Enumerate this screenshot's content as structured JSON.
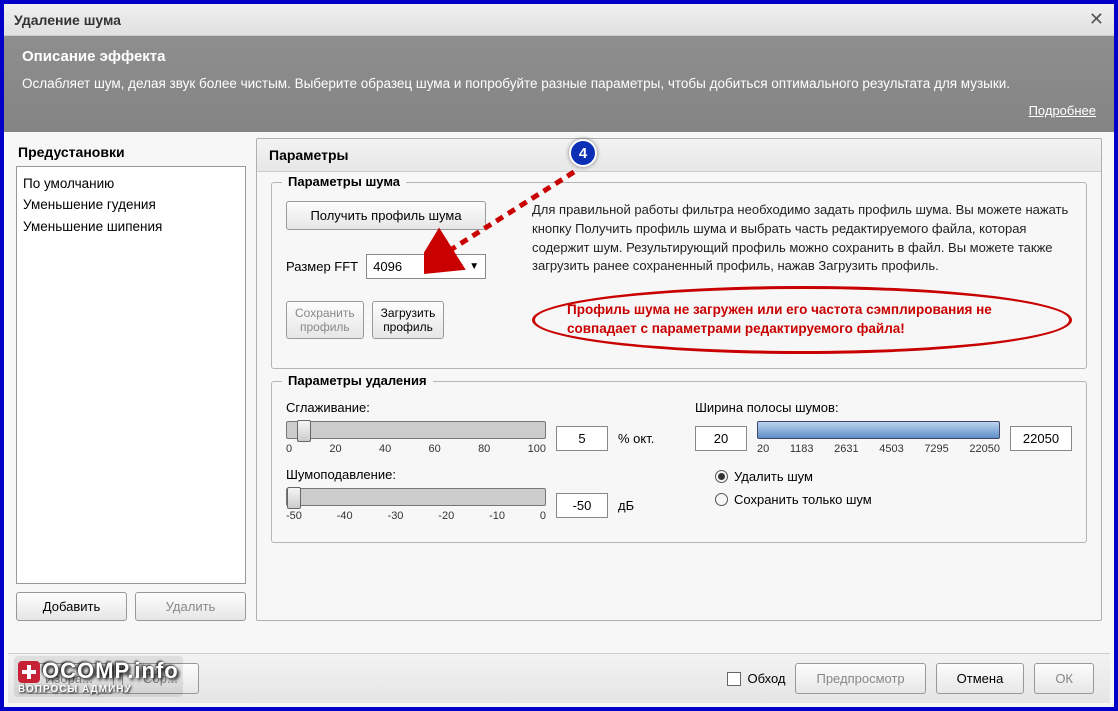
{
  "window_title": "Удаление шума",
  "description": {
    "title": "Описание эффекта",
    "text": "Ослабляет шум, делая звук более чистым. Выберите образец шума и попробуйте разные параметры, чтобы добиться оптимального результата для музыки.",
    "more": "Подробнее"
  },
  "presets": {
    "title": "Предустановки",
    "items": [
      "По умолчанию",
      "Уменьшение гудения",
      "Уменьшение шипения"
    ],
    "add": "Добавить",
    "delete": "Удалить"
  },
  "params": {
    "title": "Параметры",
    "noise_params_title": "Параметры шума",
    "get_profile": "Получить профиль шума",
    "info_text": "Для правильной работы фильтра необходимо задать профиль шума. Вы можете нажать кнопку Получить профиль шума и выбрать часть редактируемого файла, которая содержит шум. Результирующий профиль можно сохранить в файл. Вы можете также загрузить ранее сохраненный профиль, нажав Загрузить профиль.",
    "fft_label": "Размер FFT",
    "fft_value": "4096",
    "save_profile_l1": "Сохранить",
    "save_profile_l2": "профиль",
    "load_profile_l1": "Загрузить",
    "load_profile_l2": "профиль",
    "warning": "Профиль шума не загружен или его частота сэмплирования не совпадает с параметрами редактируемого файла!",
    "removal_title": "Параметры удаления",
    "smoothing_label": "Сглаживание:",
    "smoothing_value": "5",
    "smoothing_unit": "% окт.",
    "smoothing_ticks": [
      "0",
      "20",
      "40",
      "60",
      "80",
      "100"
    ],
    "reduction_label": "Шумоподавление:",
    "reduction_value": "-50",
    "reduction_unit": "дБ",
    "reduction_ticks": [
      "-50",
      "-40",
      "-30",
      "-20",
      "-10",
      "0"
    ],
    "band_label": "Ширина полосы шумов:",
    "band_low": "20",
    "band_high": "22050",
    "band_ticks": [
      "20",
      "1183",
      "2631",
      "4503",
      "7295",
      "22050"
    ],
    "radio_remove": "Удалить шум",
    "radio_keep": "Сохранить только шум"
  },
  "bottom": {
    "bypass": "Обход",
    "preview": "Предпросмотр",
    "cancel": "Отмена",
    "ok": "ОК"
  },
  "annotation": {
    "number": "4"
  },
  "logo": {
    "main": "OCOMP.info",
    "sub": "ВОПРОСЫ АДМИНУ"
  }
}
